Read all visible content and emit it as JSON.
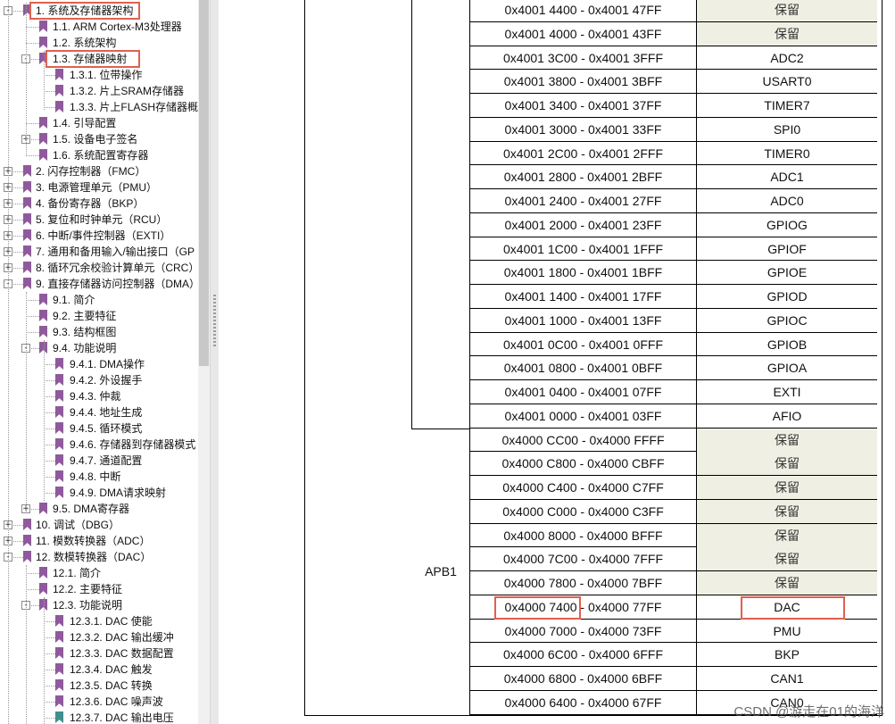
{
  "colors": {
    "highlight": "#e06050",
    "bookmark": "#8f5a9c",
    "bookmark_teal": "#3f8f8d",
    "reserved_bg": "#efefe3"
  },
  "tree": [
    {
      "label": "1. 系统及存储器架构",
      "level": 0,
      "toggle": "-",
      "highlight": true
    },
    {
      "label": "1.1. ARM Cortex-M3处理器",
      "level": 1,
      "toggle": ""
    },
    {
      "label": "1.2. 系统架构",
      "level": 1,
      "toggle": ""
    },
    {
      "label": "1.3. 存储器映射",
      "level": 1,
      "toggle": "-",
      "highlight": true
    },
    {
      "label": "1.3.1. 位带操作",
      "level": 2,
      "toggle": ""
    },
    {
      "label": "1.3.2. 片上SRAM存储器",
      "level": 2,
      "toggle": ""
    },
    {
      "label": "1.3.3. 片上FLASH存储器概",
      "level": 2,
      "toggle": ""
    },
    {
      "label": "1.4. 引导配置",
      "level": 1,
      "toggle": ""
    },
    {
      "label": "1.5. 设备电子签名",
      "level": 1,
      "toggle": "+"
    },
    {
      "label": "1.6. 系统配置寄存器",
      "level": 1,
      "toggle": ""
    },
    {
      "label": "2. 闪存控制器（FMC）",
      "level": 0,
      "toggle": "+"
    },
    {
      "label": "3. 电源管理单元（PMU）",
      "level": 0,
      "toggle": "+"
    },
    {
      "label": "4. 备份寄存器（BKP）",
      "level": 0,
      "toggle": "+"
    },
    {
      "label": "5. 复位和时钟单元（RCU）",
      "level": 0,
      "toggle": "+"
    },
    {
      "label": "6. 中断/事件控制器（EXTI）",
      "level": 0,
      "toggle": "+"
    },
    {
      "label": "7. 通用和备用输入/输出接口（GP",
      "level": 0,
      "toggle": "+"
    },
    {
      "label": "8. 循环冗余校验计算单元（CRC）",
      "level": 0,
      "toggle": "+"
    },
    {
      "label": "9. 直接存储器访问控制器（DMA）",
      "level": 0,
      "toggle": "-"
    },
    {
      "label": "9.1. 简介",
      "level": 1,
      "toggle": ""
    },
    {
      "label": "9.2. 主要特征",
      "level": 1,
      "toggle": ""
    },
    {
      "label": "9.3. 结构框图",
      "level": 1,
      "toggle": ""
    },
    {
      "label": "9.4. 功能说明",
      "level": 1,
      "toggle": "-"
    },
    {
      "label": "9.4.1. DMA操作",
      "level": 2,
      "toggle": ""
    },
    {
      "label": "9.4.2. 外设握手",
      "level": 2,
      "toggle": ""
    },
    {
      "label": "9.4.3. 仲裁",
      "level": 2,
      "toggle": ""
    },
    {
      "label": "9.4.4. 地址生成",
      "level": 2,
      "toggle": ""
    },
    {
      "label": "9.4.5. 循环模式",
      "level": 2,
      "toggle": ""
    },
    {
      "label": "9.4.6. 存储器到存储器模式",
      "level": 2,
      "toggle": ""
    },
    {
      "label": "9.4.7. 通道配置",
      "level": 2,
      "toggle": ""
    },
    {
      "label": "9.4.8. 中断",
      "level": 2,
      "toggle": ""
    },
    {
      "label": "9.4.9. DMA请求映射",
      "level": 2,
      "toggle": ""
    },
    {
      "label": "9.5. DMA寄存器",
      "level": 1,
      "toggle": "+"
    },
    {
      "label": "10. 调试（DBG）",
      "level": 0,
      "toggle": "+"
    },
    {
      "label": "11. 模数转换器（ADC）",
      "level": 0,
      "toggle": "+"
    },
    {
      "label": "12. 数模转换器（DAC）",
      "level": 0,
      "toggle": "-"
    },
    {
      "label": "12.1. 简介",
      "level": 1,
      "toggle": ""
    },
    {
      "label": "12.2. 主要特征",
      "level": 1,
      "toggle": ""
    },
    {
      "label": "12.3. 功能说明",
      "level": 1,
      "toggle": "-"
    },
    {
      "label": "12.3.1. DAC 使能",
      "level": 2,
      "toggle": ""
    },
    {
      "label": "12.3.2. DAC 输出缓冲",
      "level": 2,
      "toggle": ""
    },
    {
      "label": "12.3.3. DAC 数据配置",
      "level": 2,
      "toggle": ""
    },
    {
      "label": "12.3.4. DAC 触发",
      "level": 2,
      "toggle": ""
    },
    {
      "label": "12.3.5. DAC 转换",
      "level": 2,
      "toggle": ""
    },
    {
      "label": "12.3.6. DAC 噪声波",
      "level": 2,
      "toggle": ""
    },
    {
      "label": "12.3.7. DAC 输出电压",
      "level": 2,
      "toggle": "",
      "teal": true
    }
  ],
  "table": {
    "bus_label": "APB1",
    "rows": [
      {
        "addr": "0x4001 4400 - 0x4001 47FF",
        "periph": "保留",
        "reserved": true
      },
      {
        "addr": "0x4001 4000 - 0x4001 43FF",
        "periph": "保留",
        "reserved": true
      },
      {
        "addr": "0x4001 3C00 - 0x4001 3FFF",
        "periph": "ADC2"
      },
      {
        "addr": "0x4001 3800 - 0x4001 3BFF",
        "periph": "USART0"
      },
      {
        "addr": "0x4001 3400 - 0x4001 37FF",
        "periph": "TIMER7"
      },
      {
        "addr": "0x4001 3000 - 0x4001 33FF",
        "periph": "SPI0"
      },
      {
        "addr": "0x4001 2C00 - 0x4001 2FFF",
        "periph": "TIMER0"
      },
      {
        "addr": "0x4001 2800 - 0x4001 2BFF",
        "periph": "ADC1"
      },
      {
        "addr": "0x4001 2400 - 0x4001 27FF",
        "periph": "ADC0"
      },
      {
        "addr": "0x4001 2000 - 0x4001 23FF",
        "periph": "GPIOG"
      },
      {
        "addr": "0x4001 1C00 - 0x4001 1FFF",
        "periph": "GPIOF"
      },
      {
        "addr": "0x4001 1800 - 0x4001 1BFF",
        "periph": "GPIOE"
      },
      {
        "addr": "0x4001 1400 - 0x4001 17FF",
        "periph": "GPIOD"
      },
      {
        "addr": "0x4001 1000 - 0x4001 13FF",
        "periph": "GPIOC"
      },
      {
        "addr": "0x4001 0C00 - 0x4001 0FFF",
        "periph": "GPIOB"
      },
      {
        "addr": "0x4001 0800 - 0x4001 0BFF",
        "periph": "GPIOA"
      },
      {
        "addr": "0x4001 0400 - 0x4001 07FF",
        "periph": "EXTI"
      },
      {
        "addr": "0x4001 0000 - 0x4001 03FF",
        "periph": "AFIO"
      },
      {
        "addr": "0x4000 CC00 - 0x4000 FFFF",
        "periph": "保留",
        "reserved": true
      },
      {
        "addr": "0x4000 C800 - 0x4000 CBFF",
        "periph": "保留",
        "reserved": true
      },
      {
        "addr": "0x4000 C400 - 0x4000 C7FF",
        "periph": "保留",
        "reserved": true
      },
      {
        "addr": "0x4000 C000 - 0x4000 C3FF",
        "periph": "保留",
        "reserved": true
      },
      {
        "addr": "0x4000 8000 - 0x4000 BFFF",
        "periph": "保留",
        "reserved": true
      },
      {
        "addr": "0x4000 7C00 - 0x4000 7FFF",
        "periph": "保留",
        "reserved": true
      },
      {
        "addr": "0x4000 7800 - 0x4000 7BFF",
        "periph": "保留",
        "reserved": true
      },
      {
        "addr": "0x4000 7400 - 0x4000 77FF",
        "periph": "DAC",
        "highlight": true
      },
      {
        "addr": "0x4000 7000 - 0x4000 73FF",
        "periph": "PMU"
      },
      {
        "addr": "0x4000 6C00 - 0x4000 6FFF",
        "periph": "BKP"
      },
      {
        "addr": "0x4000 6800 - 0x4000 6BFF",
        "periph": "CAN1"
      },
      {
        "addr": "0x4000 6400 - 0x4000 67FF",
        "periph": "CAN0"
      }
    ]
  },
  "watermark": "CSDN @游走在01的海洋"
}
